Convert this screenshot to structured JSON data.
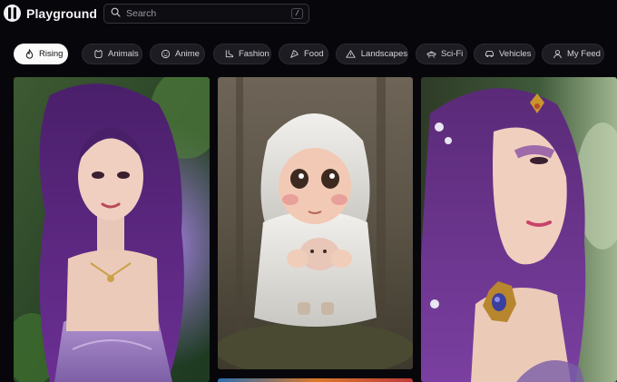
{
  "app": {
    "name": "Playground"
  },
  "search": {
    "placeholder": "Search",
    "shortcut": "/"
  },
  "filters": [
    {
      "label": "Rising",
      "icon": "flame-icon",
      "active": true
    },
    {
      "label": "Animals",
      "icon": "cat-icon",
      "active": false
    },
    {
      "label": "Anime",
      "icon": "face-icon",
      "active": false
    },
    {
      "label": "Fashion",
      "icon": "boot-icon",
      "active": false
    },
    {
      "label": "Food",
      "icon": "pizza-icon",
      "active": false
    },
    {
      "label": "Landscapes",
      "icon": "mountain-icon",
      "active": false
    },
    {
      "label": "Sci-Fi",
      "icon": "ufo-icon",
      "active": false
    },
    {
      "label": "Vehicles",
      "icon": "car-icon",
      "active": false
    },
    {
      "label": "My Feed",
      "icon": "user-icon",
      "active": false
    }
  ],
  "colors": {
    "background": "#07070b",
    "chip": "#1c1c22",
    "chip_active": "#fafafa",
    "accent_purple": "#7a3fa0"
  }
}
